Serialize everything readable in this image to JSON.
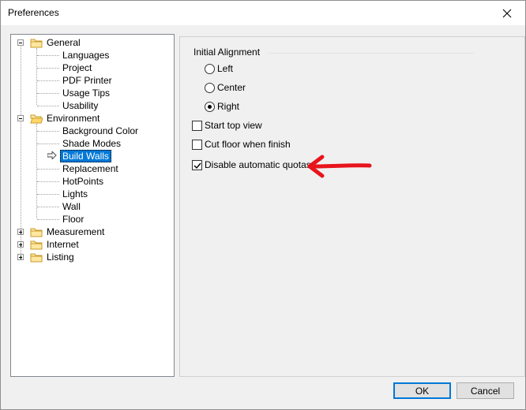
{
  "window": {
    "title": "Preferences"
  },
  "tree": {
    "general": {
      "label": "General",
      "children": [
        "Languages",
        "Project",
        "PDF Printer",
        "Usage Tips",
        "Usability"
      ]
    },
    "environment": {
      "label": "Environment",
      "children": [
        "Background Color",
        "Shade Modes",
        "Build Walls",
        "Replacement",
        "HotPoints",
        "Lights",
        "Wall",
        "Floor"
      ]
    },
    "measurement": {
      "label": "Measurement"
    },
    "internet": {
      "label": "Internet"
    },
    "listing": {
      "label": "Listing"
    },
    "selected": "Build Walls"
  },
  "panel": {
    "group_label": "Initial Alignment",
    "radios": [
      "Left",
      "Center",
      "Right"
    ],
    "selected_radio": "Right",
    "checkboxes": [
      {
        "label": "Start top view",
        "checked": false
      },
      {
        "label": "Cut floor when finish",
        "checked": false
      },
      {
        "label": "Disable automatic quotas",
        "checked": true
      }
    ]
  },
  "buttons": {
    "ok": "OK",
    "cancel": "Cancel"
  },
  "colors": {
    "selection": "#0078d7",
    "annotation_arrow": "#e8141c"
  }
}
